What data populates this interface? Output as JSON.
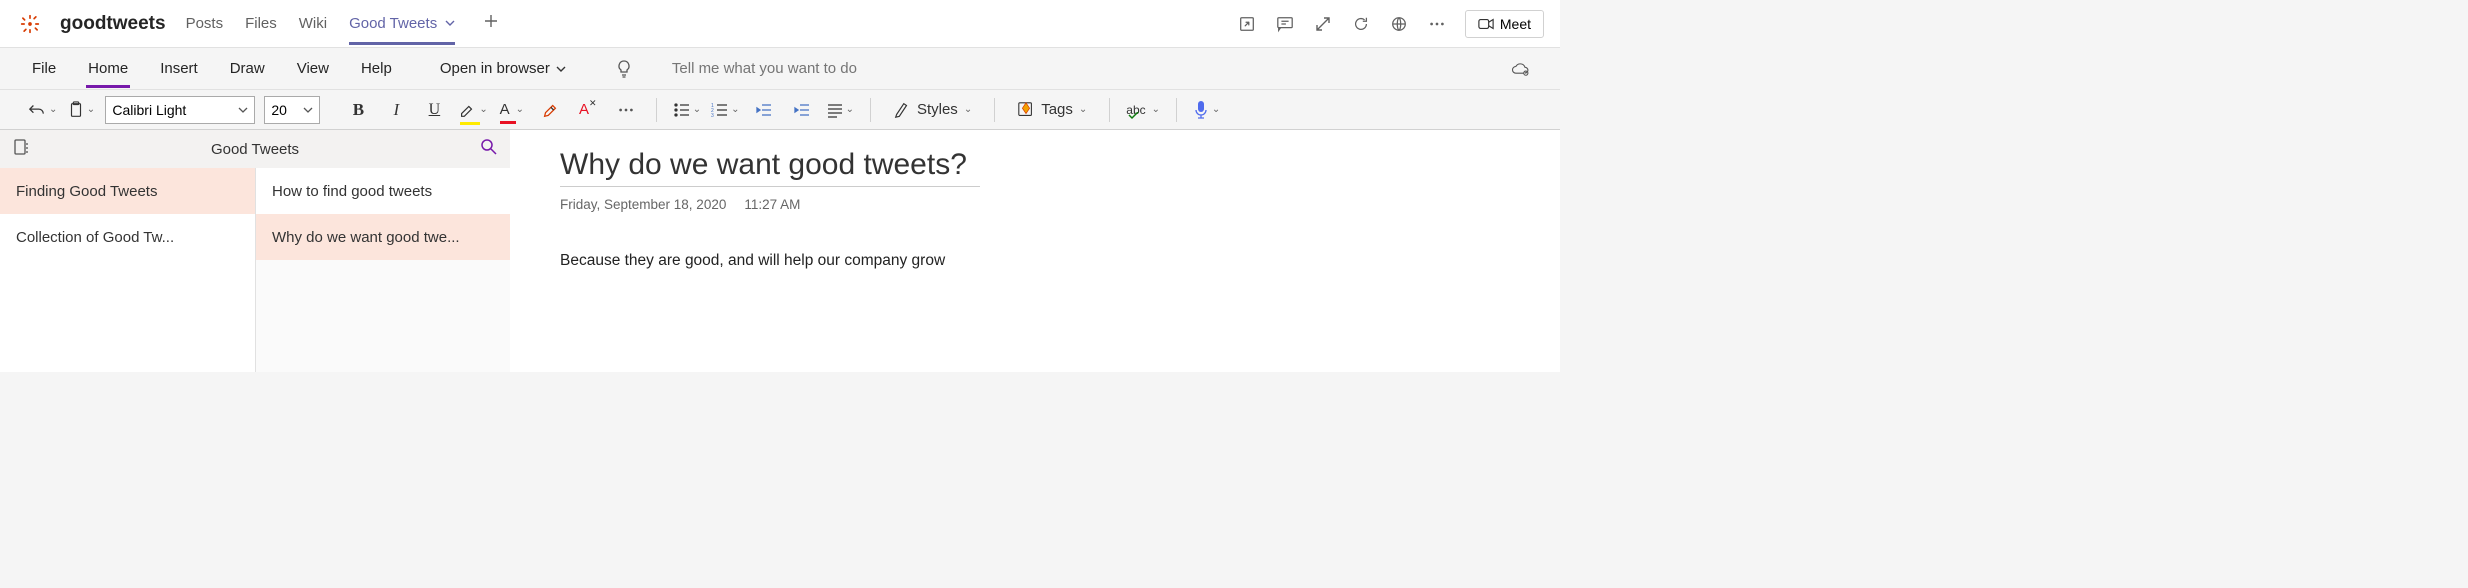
{
  "team_name": "goodtweets",
  "tabs": [
    "Posts",
    "Files",
    "Wiki",
    "Good Tweets"
  ],
  "active_tab_index": 3,
  "meet_label": "Meet",
  "ribbon": {
    "tabs": [
      "File",
      "Home",
      "Insert",
      "Draw",
      "View",
      "Help"
    ],
    "active_index": 1,
    "open_browser": "Open in browser",
    "tell_me_placeholder": "Tell me what you want to do"
  },
  "toolbar": {
    "font_name": "Calibri Light",
    "font_size": "20",
    "styles_label": "Styles",
    "tags_label": "Tags"
  },
  "nav": {
    "notebook_title": "Good Tweets",
    "sections": [
      "Finding Good Tweets",
      "Collection of Good Tw..."
    ],
    "selected_section_index": 0,
    "pages": [
      "How to find good tweets",
      "Why do we want good twe..."
    ],
    "selected_page_index": 1
  },
  "page": {
    "title": "Why do we want good tweets?",
    "date": "Friday, September 18, 2020",
    "time": "11:27 AM",
    "body": "Because they are good, and will help our company grow"
  }
}
